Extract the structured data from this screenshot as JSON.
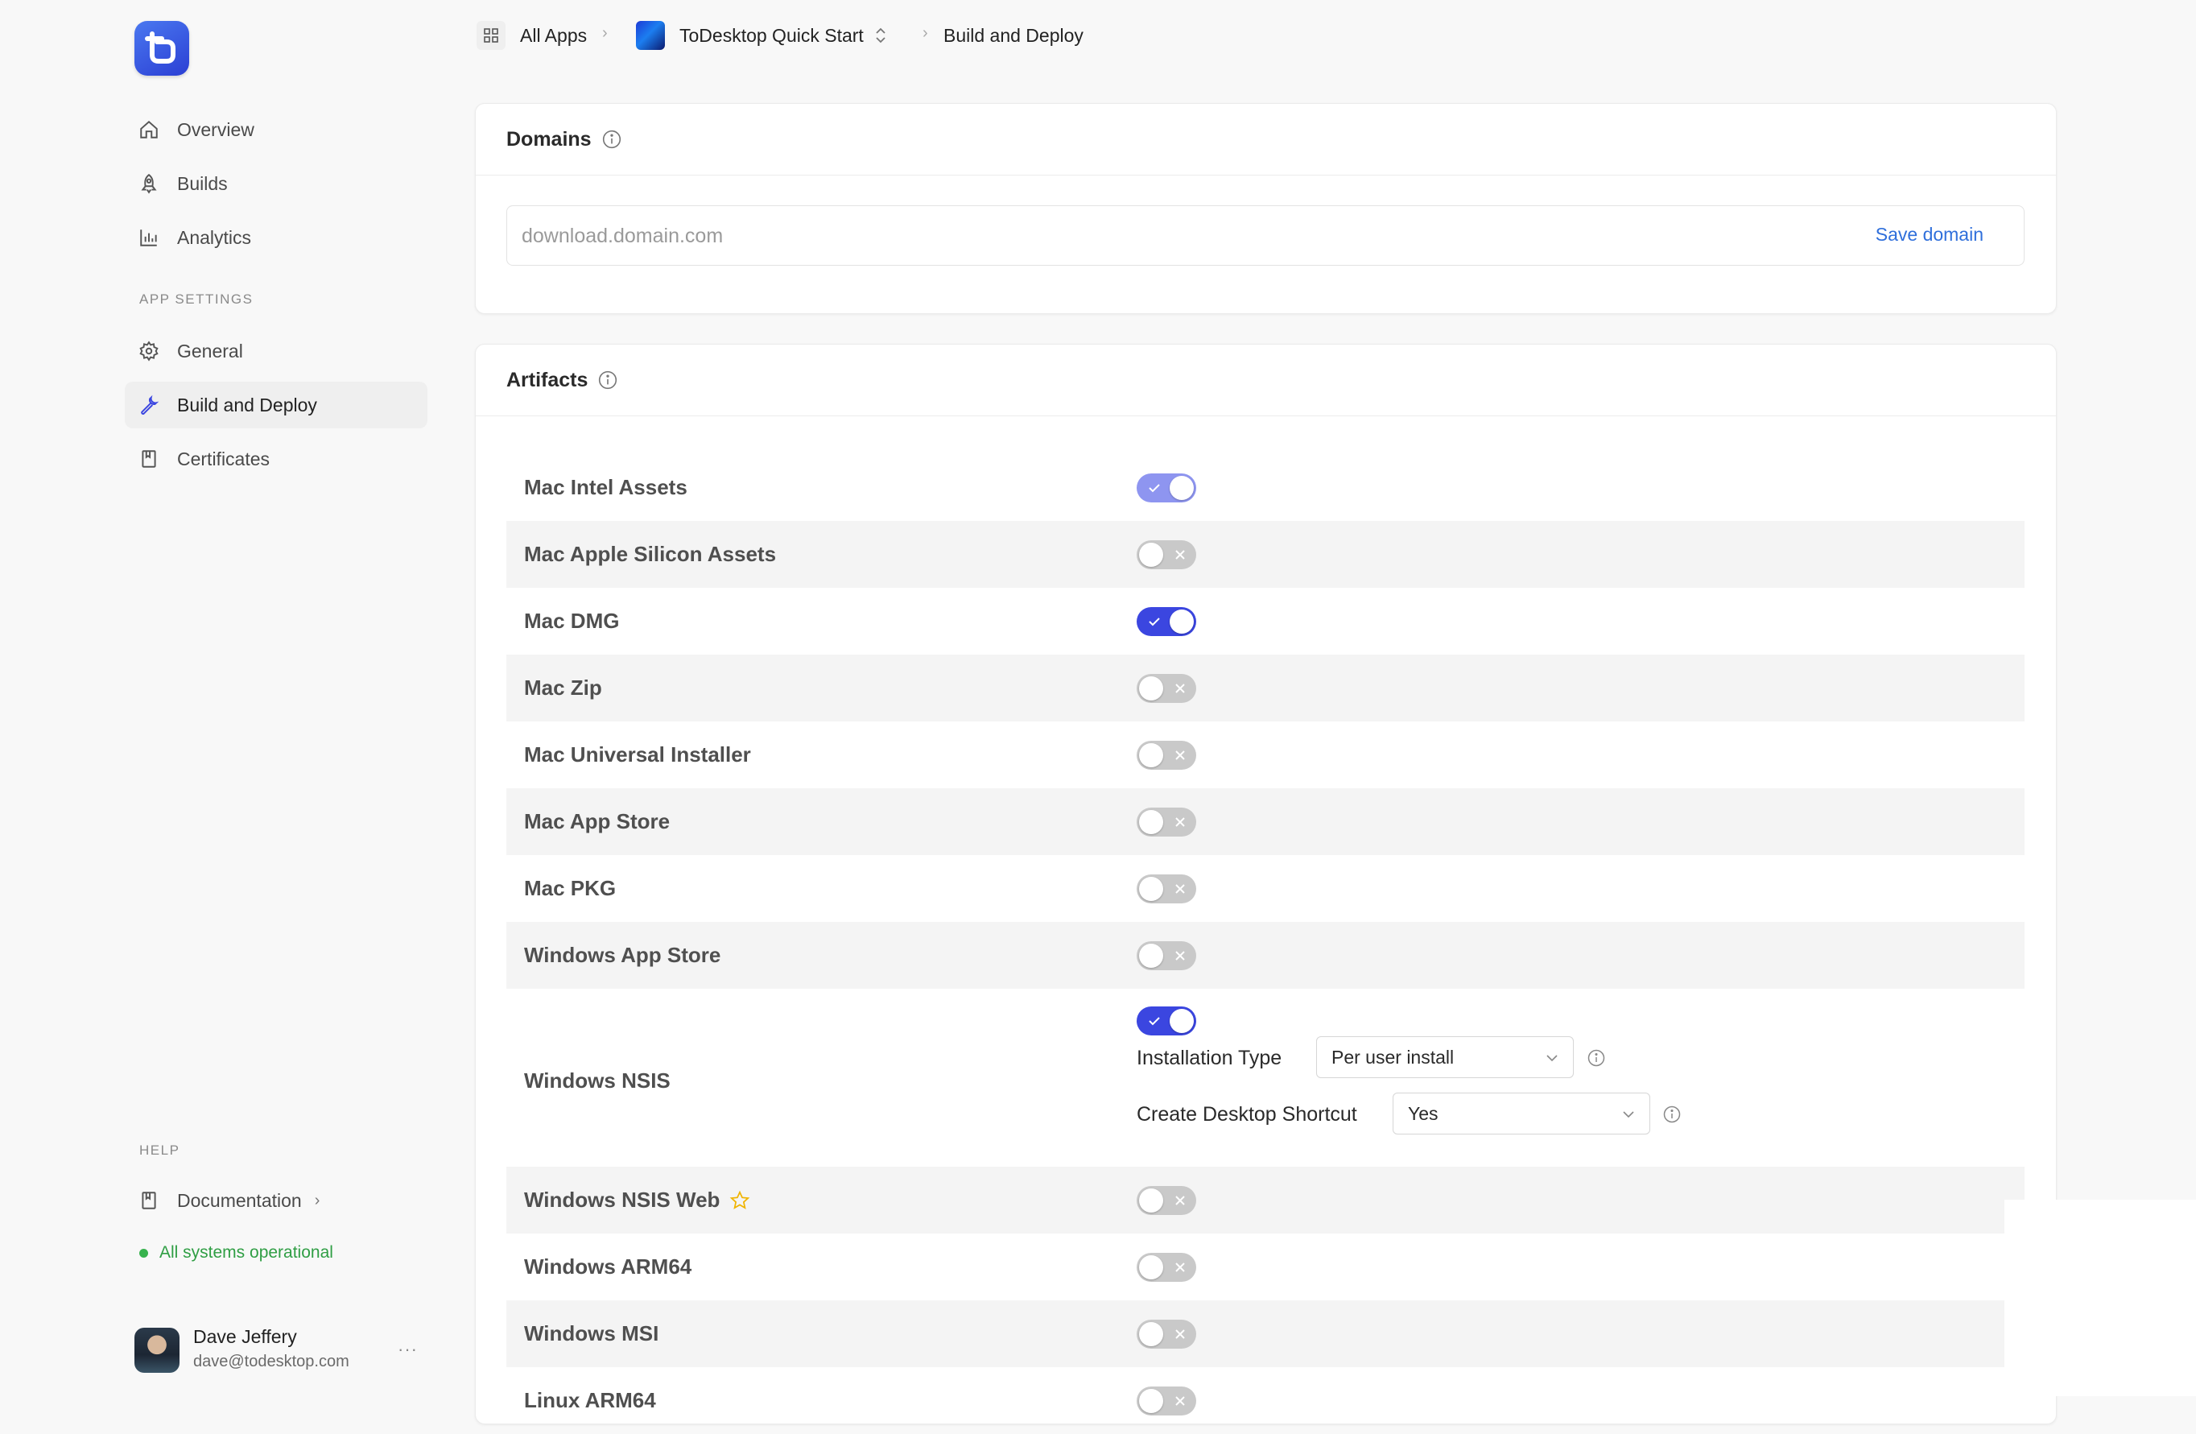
{
  "breadcrumb": {
    "all_apps": "All Apps",
    "app_name": "ToDesktop Quick Start",
    "current": "Build and Deploy"
  },
  "sidebar": {
    "nav": [
      {
        "label": "Overview",
        "icon": "home-icon"
      },
      {
        "label": "Builds",
        "icon": "rocket-icon"
      },
      {
        "label": "Analytics",
        "icon": "bar-chart-icon"
      }
    ],
    "app_settings_label": "APP SETTINGS",
    "settings": [
      {
        "label": "General",
        "icon": "gear-icon"
      },
      {
        "label": "Build and Deploy",
        "icon": "wrench-icon",
        "active": true
      },
      {
        "label": "Certificates",
        "icon": "bookmark-icon"
      }
    ],
    "help_label": "HELP",
    "documentation": "Documentation",
    "status": "All systems operational",
    "user": {
      "name": "Dave Jeffery",
      "email": "dave@todesktop.com",
      "more": "···"
    }
  },
  "domains": {
    "title": "Domains",
    "placeholder": "download.domain.com",
    "value": "",
    "save_label": "Save domain"
  },
  "artifacts": {
    "title": "Artifacts",
    "rows": [
      {
        "label": "Mac Intel Assets",
        "enabled": true
      },
      {
        "label": "Mac Apple Silicon Assets",
        "enabled": false
      },
      {
        "label": "Mac DMG",
        "enabled": true
      },
      {
        "label": "Mac Zip",
        "enabled": false
      },
      {
        "label": "Mac Universal Installer",
        "enabled": false
      },
      {
        "label": "Mac App Store",
        "enabled": false
      },
      {
        "label": "Mac PKG",
        "enabled": false
      },
      {
        "label": "Windows App Store",
        "enabled": false
      },
      {
        "label": "Windows NSIS",
        "enabled": true
      },
      {
        "label": "Windows NSIS Web",
        "enabled": false
      },
      {
        "label": "Windows ARM64",
        "enabled": false
      },
      {
        "label": "Windows MSI",
        "enabled": false
      },
      {
        "label": "Linux ARM64",
        "enabled": false
      }
    ],
    "nsis_options": {
      "installation_type_label": "Installation Type",
      "installation_type_value": "Per user install",
      "desktop_shortcut_label": "Create Desktop Shortcut",
      "desktop_shortcut_value": "Yes"
    }
  },
  "colors": {
    "accent": "#3b46e0",
    "accent_light": "#8e95f0",
    "link": "#2f6fdb",
    "status_green": "#37b24d",
    "star": "#f0b400"
  }
}
